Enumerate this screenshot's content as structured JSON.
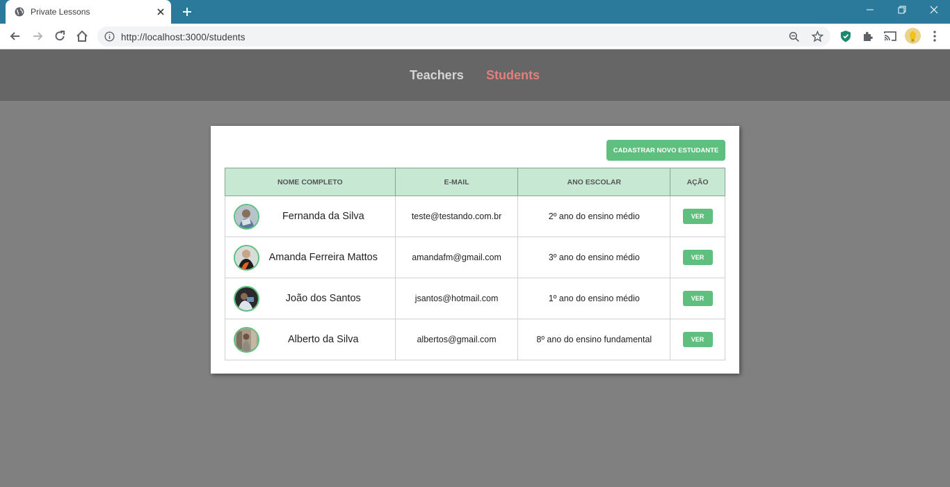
{
  "browser": {
    "tab_title": "Private Lessons",
    "url": "http://localhost:3000/students"
  },
  "nav": {
    "teachers": "Teachers",
    "students": "Students",
    "active": "Students"
  },
  "page": {
    "create_button": "CADASTRAR NOVO ESTUDANTE",
    "table_headers": [
      "NOME COMPLETO",
      "E-MAIL",
      "ANO ESCOLAR",
      "AÇÃO"
    ],
    "students": [
      {
        "name": "Fernanda da Silva",
        "email": "teste@testando.com.br",
        "grade": "2º ano do ensino médio",
        "action": "VER"
      },
      {
        "name": "Amanda Ferreira Mattos",
        "email": "amandafm@gmail.com",
        "grade": "3º ano do ensino médio",
        "action": "VER"
      },
      {
        "name": "João dos Santos",
        "email": "jsantos@hotmail.com",
        "grade": "1º ano do ensino médio",
        "action": "VER"
      },
      {
        "name": "Alberto da Silva",
        "email": "albertos@gmail.com",
        "grade": "8º ano do ensino fundamental",
        "action": "VER"
      }
    ]
  },
  "colors": {
    "accent_green": "#5fbf7f",
    "header_green": "#c7e9d4",
    "active_nav": "#e57e7e",
    "titlebar": "#2b7a9b"
  }
}
